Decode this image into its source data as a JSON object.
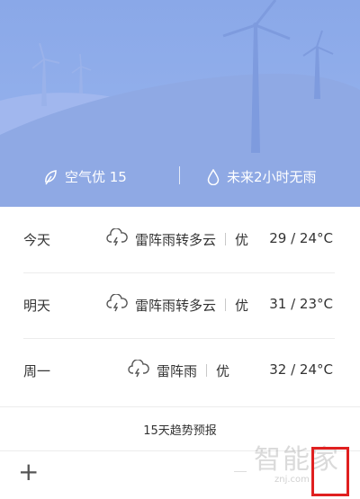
{
  "hero": {
    "air_label": "空气优 15",
    "rain_label": "未来2小时无雨",
    "air_icon": "leaf-icon",
    "rain_icon": "drop-icon",
    "scene": "wind-turbines-hills",
    "color": "#8aa8e8"
  },
  "forecast": {
    "days": [
      {
        "day": "今天",
        "condition": "雷阵雨转多云",
        "air": "优",
        "temp": "29 / 24°C",
        "icon": "thunderstorm-icon"
      },
      {
        "day": "明天",
        "condition": "雷阵雨转多云",
        "air": "优",
        "temp": "31 / 23°C",
        "icon": "thunderstorm-icon"
      },
      {
        "day": "周一",
        "condition": "雷阵雨",
        "air": "优",
        "temp": "32 / 24°C",
        "icon": "thunderstorm-icon"
      }
    ],
    "trend_label": "15天趋势预报"
  },
  "bottom": {
    "add_label": "+",
    "watermark": "智能家",
    "watermark_sub": "znj.com",
    "highlight_color": "#e02020"
  }
}
